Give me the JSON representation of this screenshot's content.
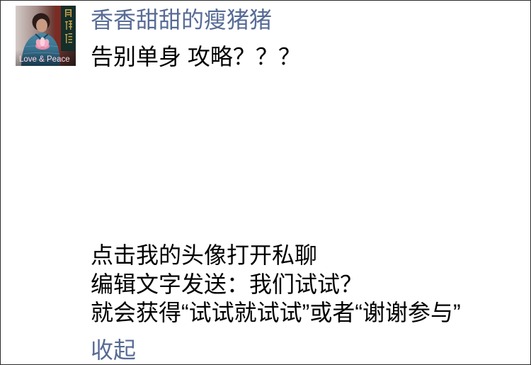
{
  "post": {
    "avatar": {
      "icon": "user-avatar-photo",
      "overlay_text": "Love & Peace"
    },
    "username": "香香甜甜的瘦猪猪",
    "title_text": "告别单身 攻略？？？",
    "body_lines": [
      "点击我的头像打开私聊",
      "编辑文字发送：我们试试？",
      "就会获得“试试就试试”或者“谢谢参与”"
    ],
    "collapse_label": "收起"
  },
  "colors": {
    "link": "#576b95",
    "text": "#000000",
    "background": "#ffffff"
  }
}
